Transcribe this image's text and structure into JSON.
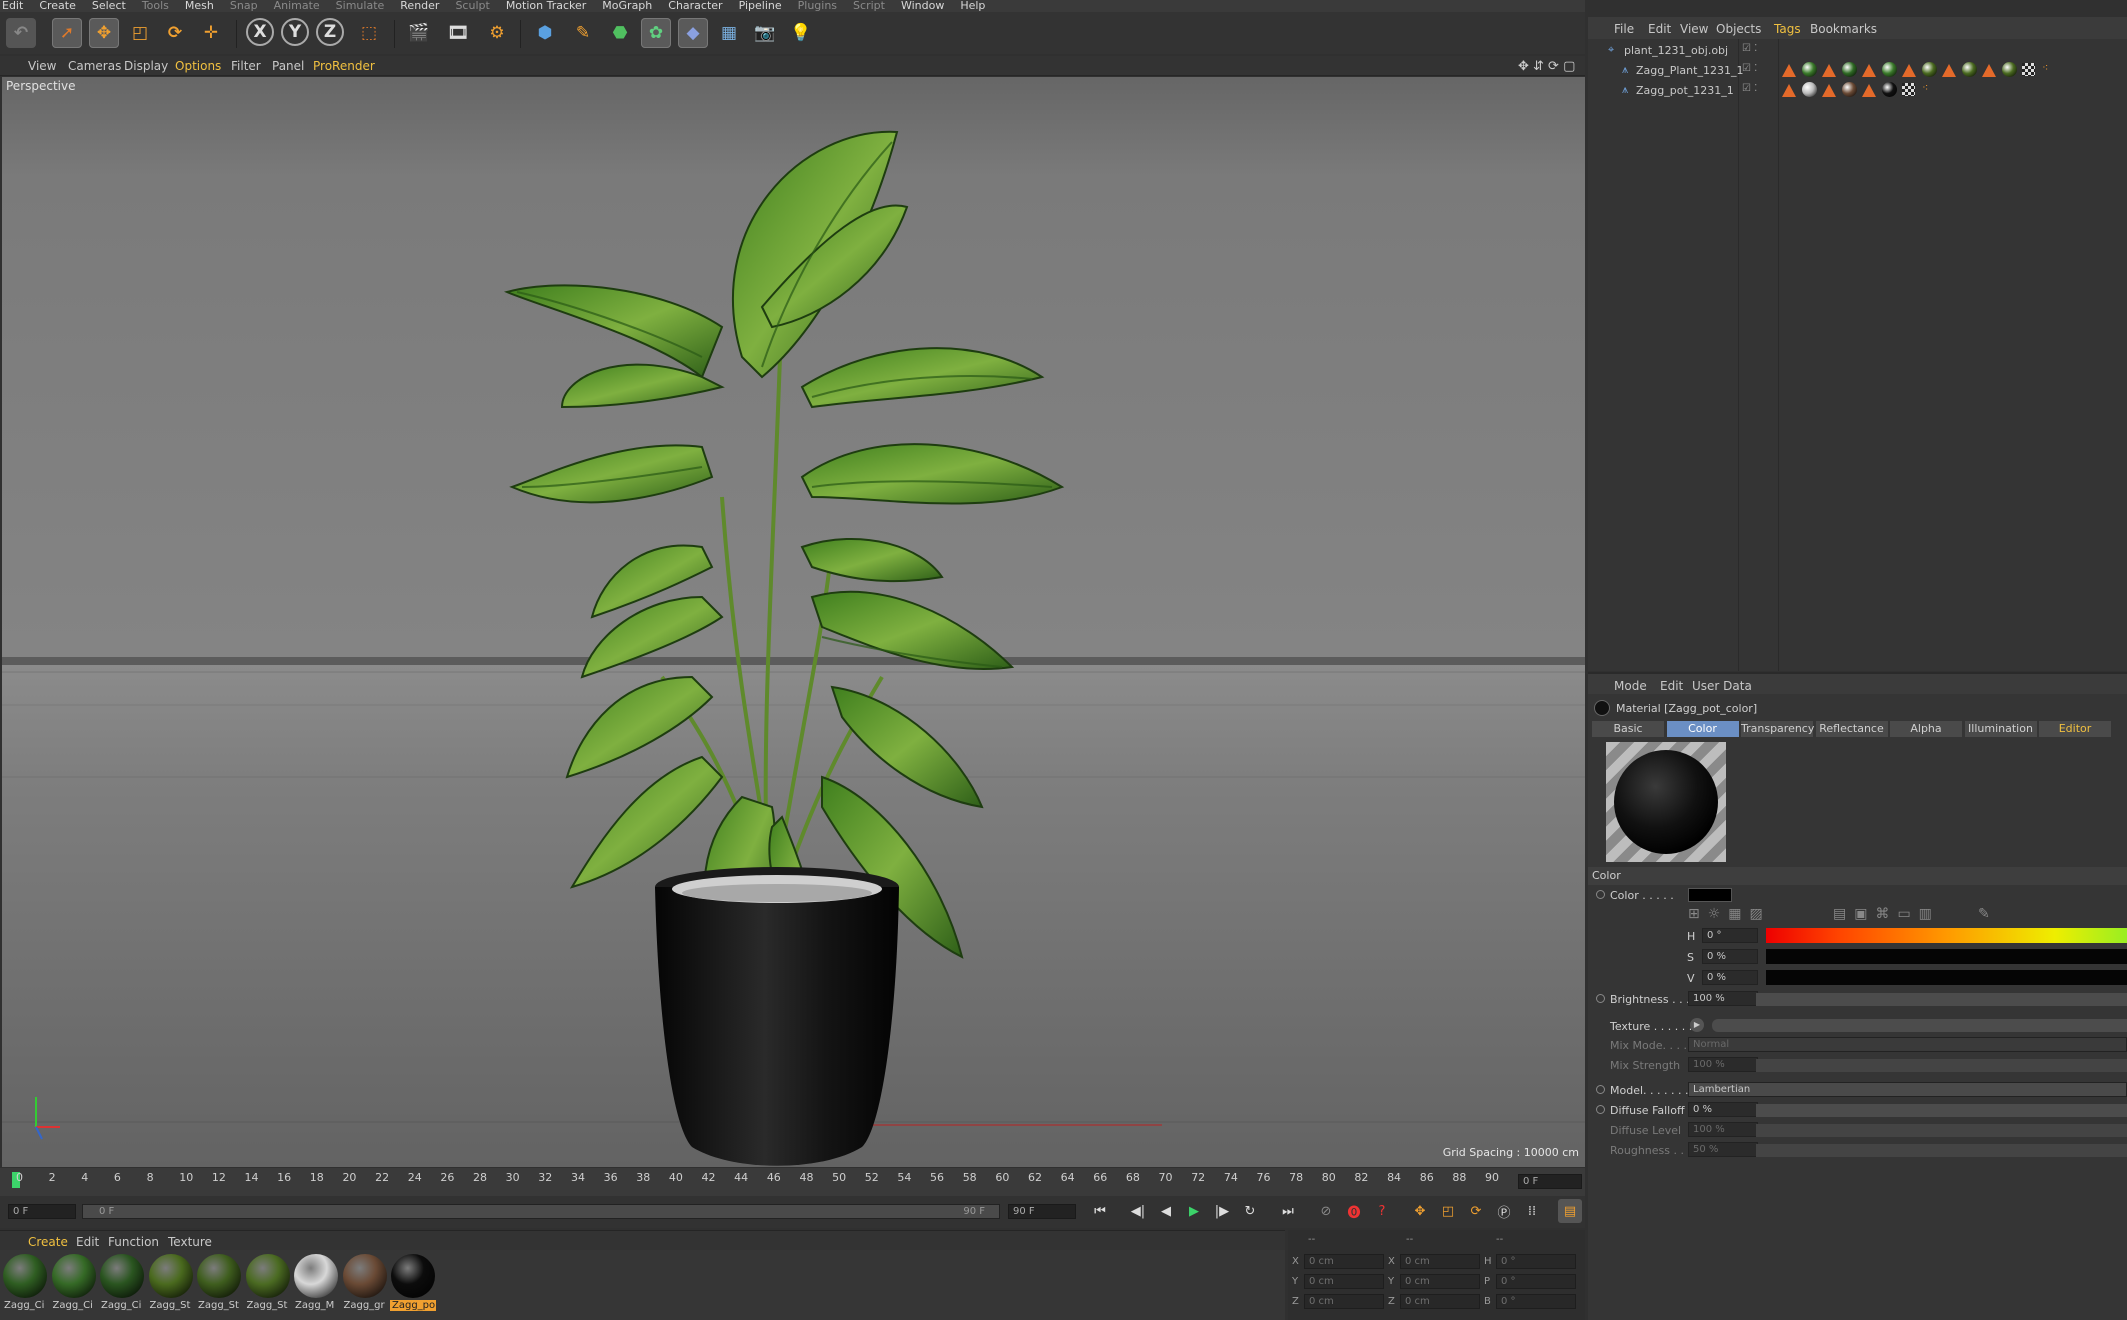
{
  "menu": [
    "Edit",
    "Create",
    "Select",
    "Tools",
    "Mesh",
    "Snap",
    "Animate",
    "Simulate",
    "Render",
    "Sculpt",
    "Motion Tracker",
    "MoGraph",
    "Character",
    "Pipeline",
    "Plugins",
    "Script",
    "Window",
    "Help"
  ],
  "viewport": {
    "menu": [
      "View",
      "Cameras",
      "Display",
      "Options",
      "Filter",
      "Panel",
      "ProRender"
    ],
    "label": "Perspective",
    "grid_spacing": "Grid Spacing : 10000 cm"
  },
  "timeline": {
    "ticks": [
      "0",
      "2",
      "4",
      "6",
      "8",
      "10",
      "12",
      "14",
      "16",
      "18",
      "20",
      "22",
      "24",
      "26",
      "28",
      "30",
      "32",
      "34",
      "36",
      "38",
      "40",
      "42",
      "44",
      "46",
      "48",
      "50",
      "52",
      "54",
      "56",
      "58",
      "60",
      "62",
      "64",
      "66",
      "68",
      "70",
      "72",
      "74",
      "76",
      "78",
      "80",
      "82",
      "84",
      "86",
      "88",
      "90"
    ],
    "current_frame": "0 F",
    "start_field": "0 F",
    "range_start": "0 F",
    "range_end": "90 F",
    "end_field": "90 F"
  },
  "material_manager": {
    "menu": [
      "Create",
      "Edit",
      "Function",
      "Texture"
    ],
    "items": [
      {
        "label": "Zagg_Ci",
        "color": "#2f5e22"
      },
      {
        "label": "Zagg_Ci",
        "color": "#356a26"
      },
      {
        "label": "Zagg_Ci",
        "color": "#2a5520"
      },
      {
        "label": "Zagg_St",
        "color": "#4a6a1e"
      },
      {
        "label": "Zagg_St",
        "color": "#3f5e1e"
      },
      {
        "label": "Zagg_St",
        "color": "#4b6b22"
      },
      {
        "label": "Zagg_M",
        "color": "#d8d8d8"
      },
      {
        "label": "Zagg_gr",
        "color": "#6a4a35"
      },
      {
        "label": "Zagg_po",
        "color": "#0c0c0c",
        "selected": true
      }
    ]
  },
  "coordinates": {
    "header": [
      "--",
      "--",
      "--"
    ],
    "rows": [
      {
        "a": "X",
        "a_val": "0 cm",
        "b": "X",
        "b_val": "0 cm",
        "c": "H",
        "c_val": "0 °"
      },
      {
        "a": "Y",
        "a_val": "0 cm",
        "b": "Y",
        "b_val": "0 cm",
        "c": "P",
        "c_val": "0 °"
      },
      {
        "a": "Z",
        "a_val": "0 cm",
        "b": "Z",
        "b_val": "0 cm",
        "c": "B",
        "c_val": "0 °"
      }
    ]
  },
  "object_manager": {
    "menu": [
      "File",
      "Edit",
      "View",
      "Objects",
      "Tags",
      "Bookmarks"
    ],
    "objects": [
      {
        "name": "plant_1231_obj.obj",
        "level": 0
      },
      {
        "name": "Zagg_Plant_1231_1",
        "level": 1
      },
      {
        "name": "Zagg_pot_1231_1",
        "level": 1
      }
    ]
  },
  "attribute_manager": {
    "menu": [
      "Mode",
      "Edit",
      "User Data"
    ],
    "title": "Material [Zagg_pot_color]",
    "tabs": [
      "Basic",
      "Color",
      "Transparency",
      "Reflectance",
      "Alpha",
      "Illumination",
      "Editor"
    ],
    "active_tab": "Color",
    "section": "Color",
    "color_label": "Color . . . . .",
    "color_swatch": "#000000",
    "hsv": [
      {
        "label": "H",
        "value": "0 °"
      },
      {
        "label": "S",
        "value": "0 %"
      },
      {
        "label": "V",
        "value": "0 %"
      }
    ],
    "brightness": {
      "label": "Brightness . . .",
      "value": "100 %"
    },
    "texture": {
      "label": "Texture . . . . . ."
    },
    "mix_mode": {
      "label": "Mix Mode. . . .",
      "value": "Normal"
    },
    "mix_strength": {
      "label": "Mix Strength",
      "value": "100 %"
    },
    "model": {
      "label": "Model. . . . . . .",
      "value": "Lambertian"
    },
    "diffuse_falloff": {
      "label": "Diffuse Falloff",
      "value": "0 %"
    },
    "diffuse_level": {
      "label": "Diffuse Level",
      "value": "100 %"
    },
    "roughness": {
      "label": "Roughness . . .",
      "value": "50 %"
    }
  }
}
